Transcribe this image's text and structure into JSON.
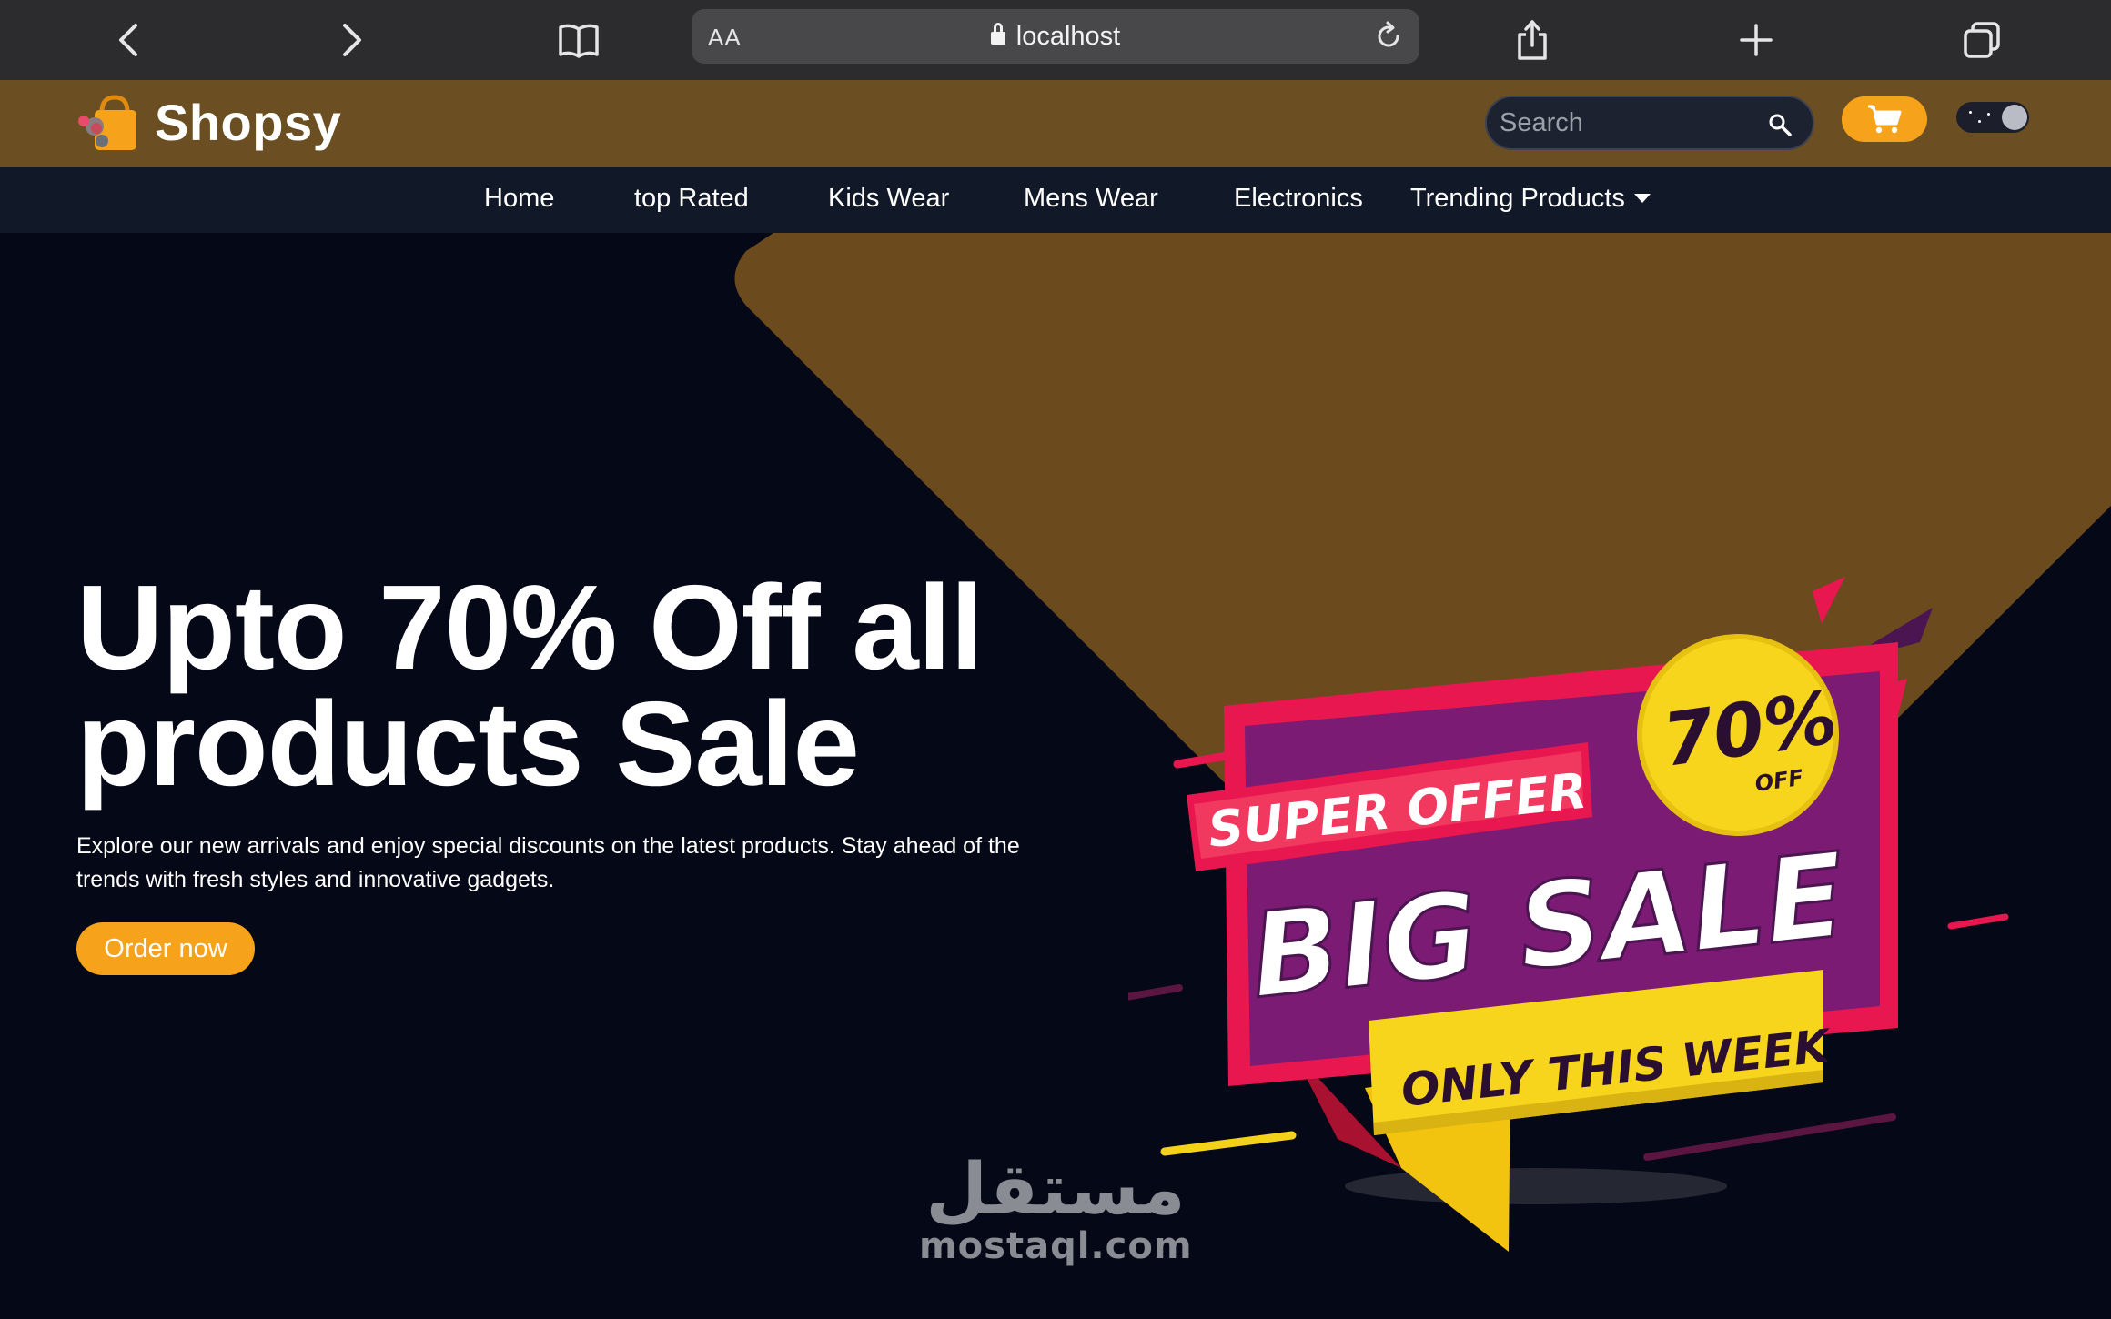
{
  "browser": {
    "url_aa": "AA",
    "url_host": "localhost",
    "back_icon": "chevron-left-icon",
    "forward_icon": "chevron-right-icon",
    "bookmarks_icon": "book-icon",
    "share_icon": "share-icon",
    "new_tab_icon": "plus-icon",
    "tabs_icon": "tabs-icon"
  },
  "header": {
    "brand": "Shopsy",
    "search_placeholder": "Search",
    "accent": "#f7a21b",
    "header_bg": "#6b4e21"
  },
  "nav": {
    "items": [
      {
        "label": "Home"
      },
      {
        "label": "top Rated"
      },
      {
        "label": "Kids Wear"
      },
      {
        "label": "Mens Wear"
      },
      {
        "label": "Electronics"
      },
      {
        "label": "Trending Products"
      }
    ]
  },
  "hero": {
    "headline": "Upto 70% Off all products Sale",
    "description": "Explore our new arrivals and enjoy special discounts on the latest products. Stay ahead of the trends with fresh styles and innovative gadgets.",
    "cta": "Order now",
    "banner": {
      "super_offer": "SUPER OFFER",
      "big_sale": "BIG SALE",
      "only_this_week": "ONLY THIS WEEK",
      "badge_percent": "70%",
      "badge_off": "OFF"
    }
  },
  "watermark": {
    "arabic": "مستقل",
    "latin": "mostaql.com"
  }
}
